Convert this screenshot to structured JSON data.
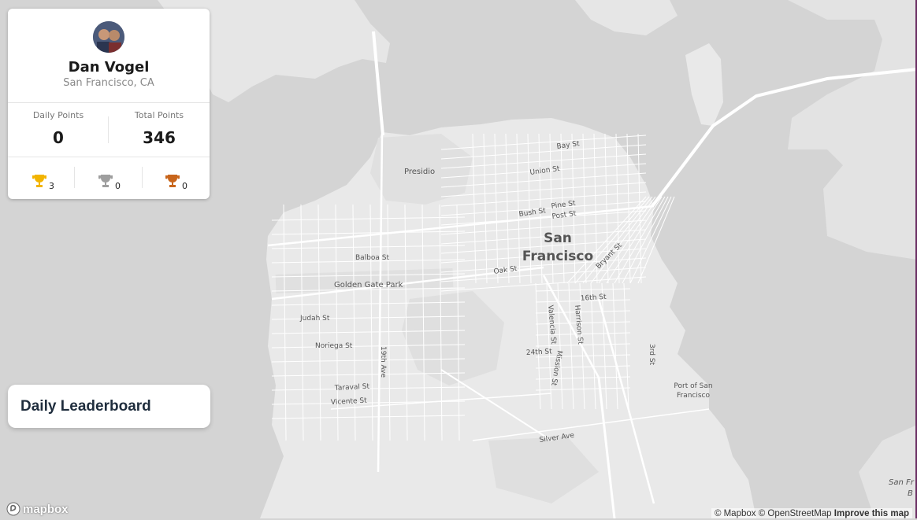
{
  "profile": {
    "name": "Dan Vogel",
    "location": "San Francisco, CA",
    "daily_points_label": "Daily Points",
    "daily_points": "0",
    "total_points_label": "Total Points",
    "total_points": "346",
    "trophies": [
      {
        "kind": "gold",
        "color": "#f2b400",
        "count": "3"
      },
      {
        "kind": "silver",
        "color": "#9e9e9e",
        "count": "0"
      },
      {
        "kind": "bronze",
        "color": "#c8651b",
        "count": "0"
      }
    ]
  },
  "leaderboard": {
    "title": "Daily Leaderboard"
  },
  "map": {
    "colors": {
      "water": "#d4d4d4",
      "land": "#e9e9e9",
      "park": "#e1e1e1",
      "road": "#ffffff"
    },
    "labels": {
      "city_line1": "San",
      "city_line2": "Francisco",
      "presidio": "Presidio",
      "bay_st": "Bay St",
      "union_st": "Union St",
      "pine_st": "Pine St",
      "bush_st": "Bush St",
      "post_st": "Post St",
      "balboa_st": "Balboa St",
      "oak_st": "Oak St",
      "bryant_st": "Bryant St",
      "golden_gate_park": "Golden Gate Park",
      "sixteenth_st": "16th St",
      "judah_st": "Judah St",
      "valencia_st": "Valencia St",
      "harrison_st": "Harrison St",
      "noriega_st": "Noriega St",
      "nineteenth_ave": "19th Ave",
      "twentyfourth_st": "24th St",
      "mission_st": "Mission St",
      "third_st": "3rd St",
      "port_line1": "Port of San",
      "port_line2": "Francisco",
      "taraval_st": "Taraval St",
      "vicente_st": "Vicente St",
      "silver_ave": "Silver Ave",
      "sanfr_partial1": "San Fr",
      "sanfr_partial2": "B"
    }
  },
  "footer": {
    "logo_text": "mapbox",
    "attribution": "© Mapbox © OpenStreetMap",
    "improve": "Improve this map"
  }
}
